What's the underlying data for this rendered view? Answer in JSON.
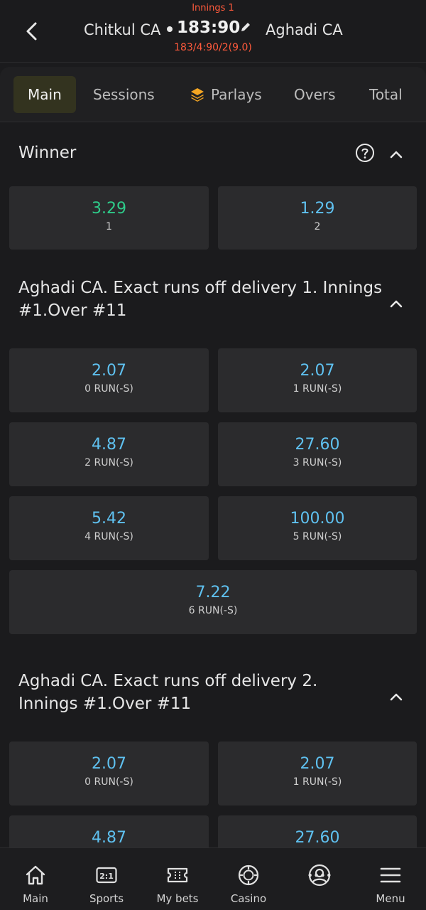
{
  "header": {
    "innings_label": "Innings 1",
    "home_team": "Chitkul CA",
    "score": "183:90",
    "away_team": "Aghadi CA",
    "sub_score": "183/4:90/2(9.0)"
  },
  "tabs": [
    {
      "label": "Main",
      "active": true
    },
    {
      "label": "Sessions"
    },
    {
      "label": "Parlays",
      "icon": "layers-icon"
    },
    {
      "label": "Overs"
    },
    {
      "label": "Total"
    }
  ],
  "winner": {
    "title": "Winner",
    "odds": [
      {
        "value": "3.29",
        "label": "1",
        "color": "#2ecc8a"
      },
      {
        "value": "1.29",
        "label": "2"
      }
    ]
  },
  "market1": {
    "title_line1": "Aghadi CA. Exact runs off delivery 1. Innings",
    "title_line2": "#1.Over #11",
    "odds": [
      {
        "value": "2.07",
        "label": "0 RUN(-S)"
      },
      {
        "value": "2.07",
        "label": "1 RUN(-S)"
      },
      {
        "value": "4.87",
        "label": "2 RUN(-S)"
      },
      {
        "value": "27.60",
        "label": "3 RUN(-S)"
      },
      {
        "value": "5.42",
        "label": "4 RUN(-S)"
      },
      {
        "value": "100.00",
        "label": "5 RUN(-S)"
      },
      {
        "value": "7.22",
        "label": "6 RUN(-S)"
      }
    ]
  },
  "market2": {
    "title_line1": "Aghadi CA. Exact runs off delivery 2.",
    "title_line2": "Innings #1.Over #11",
    "odds": [
      {
        "value": "2.07",
        "label": "0 RUN(-S)"
      },
      {
        "value": "2.07",
        "label": "1 RUN(-S)"
      },
      {
        "value": "4.87",
        "label": ""
      },
      {
        "value": "27.60",
        "label": ""
      }
    ]
  },
  "bottom_nav": [
    {
      "label": "Main",
      "icon": "home-icon"
    },
    {
      "label": "Sports",
      "icon": "scoreboard-icon"
    },
    {
      "label": "My bets",
      "icon": "ticket-icon"
    },
    {
      "label": "Casino",
      "icon": "casino-chip-icon"
    },
    {
      "label": "",
      "icon": "profile-icon"
    },
    {
      "label": "Menu",
      "icon": "menu-icon"
    }
  ],
  "colors": {
    "accent_odds": "#5fc1f0",
    "accent_green": "#2ecc8a",
    "live_red": "#ff5a3c",
    "parlays_orange": "#f5a623"
  }
}
